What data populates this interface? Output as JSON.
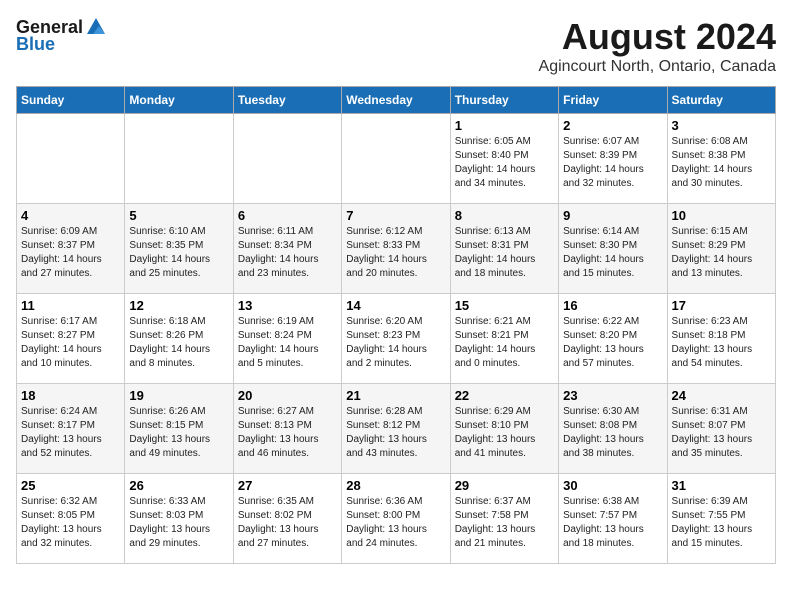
{
  "logo": {
    "general": "General",
    "blue": "Blue"
  },
  "title": {
    "month_year": "August 2024",
    "location": "Agincourt North, Ontario, Canada"
  },
  "days_of_week": [
    "Sunday",
    "Monday",
    "Tuesday",
    "Wednesday",
    "Thursday",
    "Friday",
    "Saturday"
  ],
  "weeks": [
    [
      {
        "day": "",
        "info": ""
      },
      {
        "day": "",
        "info": ""
      },
      {
        "day": "",
        "info": ""
      },
      {
        "day": "",
        "info": ""
      },
      {
        "day": "1",
        "info": "Sunrise: 6:05 AM\nSunset: 8:40 PM\nDaylight: 14 hours\nand 34 minutes."
      },
      {
        "day": "2",
        "info": "Sunrise: 6:07 AM\nSunset: 8:39 PM\nDaylight: 14 hours\nand 32 minutes."
      },
      {
        "day": "3",
        "info": "Sunrise: 6:08 AM\nSunset: 8:38 PM\nDaylight: 14 hours\nand 30 minutes."
      }
    ],
    [
      {
        "day": "4",
        "info": "Sunrise: 6:09 AM\nSunset: 8:37 PM\nDaylight: 14 hours\nand 27 minutes."
      },
      {
        "day": "5",
        "info": "Sunrise: 6:10 AM\nSunset: 8:35 PM\nDaylight: 14 hours\nand 25 minutes."
      },
      {
        "day": "6",
        "info": "Sunrise: 6:11 AM\nSunset: 8:34 PM\nDaylight: 14 hours\nand 23 minutes."
      },
      {
        "day": "7",
        "info": "Sunrise: 6:12 AM\nSunset: 8:33 PM\nDaylight: 14 hours\nand 20 minutes."
      },
      {
        "day": "8",
        "info": "Sunrise: 6:13 AM\nSunset: 8:31 PM\nDaylight: 14 hours\nand 18 minutes."
      },
      {
        "day": "9",
        "info": "Sunrise: 6:14 AM\nSunset: 8:30 PM\nDaylight: 14 hours\nand 15 minutes."
      },
      {
        "day": "10",
        "info": "Sunrise: 6:15 AM\nSunset: 8:29 PM\nDaylight: 14 hours\nand 13 minutes."
      }
    ],
    [
      {
        "day": "11",
        "info": "Sunrise: 6:17 AM\nSunset: 8:27 PM\nDaylight: 14 hours\nand 10 minutes."
      },
      {
        "day": "12",
        "info": "Sunrise: 6:18 AM\nSunset: 8:26 PM\nDaylight: 14 hours\nand 8 minutes."
      },
      {
        "day": "13",
        "info": "Sunrise: 6:19 AM\nSunset: 8:24 PM\nDaylight: 14 hours\nand 5 minutes."
      },
      {
        "day": "14",
        "info": "Sunrise: 6:20 AM\nSunset: 8:23 PM\nDaylight: 14 hours\nand 2 minutes."
      },
      {
        "day": "15",
        "info": "Sunrise: 6:21 AM\nSunset: 8:21 PM\nDaylight: 14 hours\nand 0 minutes."
      },
      {
        "day": "16",
        "info": "Sunrise: 6:22 AM\nSunset: 8:20 PM\nDaylight: 13 hours\nand 57 minutes."
      },
      {
        "day": "17",
        "info": "Sunrise: 6:23 AM\nSunset: 8:18 PM\nDaylight: 13 hours\nand 54 minutes."
      }
    ],
    [
      {
        "day": "18",
        "info": "Sunrise: 6:24 AM\nSunset: 8:17 PM\nDaylight: 13 hours\nand 52 minutes."
      },
      {
        "day": "19",
        "info": "Sunrise: 6:26 AM\nSunset: 8:15 PM\nDaylight: 13 hours\nand 49 minutes."
      },
      {
        "day": "20",
        "info": "Sunrise: 6:27 AM\nSunset: 8:13 PM\nDaylight: 13 hours\nand 46 minutes."
      },
      {
        "day": "21",
        "info": "Sunrise: 6:28 AM\nSunset: 8:12 PM\nDaylight: 13 hours\nand 43 minutes."
      },
      {
        "day": "22",
        "info": "Sunrise: 6:29 AM\nSunset: 8:10 PM\nDaylight: 13 hours\nand 41 minutes."
      },
      {
        "day": "23",
        "info": "Sunrise: 6:30 AM\nSunset: 8:08 PM\nDaylight: 13 hours\nand 38 minutes."
      },
      {
        "day": "24",
        "info": "Sunrise: 6:31 AM\nSunset: 8:07 PM\nDaylight: 13 hours\nand 35 minutes."
      }
    ],
    [
      {
        "day": "25",
        "info": "Sunrise: 6:32 AM\nSunset: 8:05 PM\nDaylight: 13 hours\nand 32 minutes."
      },
      {
        "day": "26",
        "info": "Sunrise: 6:33 AM\nSunset: 8:03 PM\nDaylight: 13 hours\nand 29 minutes."
      },
      {
        "day": "27",
        "info": "Sunrise: 6:35 AM\nSunset: 8:02 PM\nDaylight: 13 hours\nand 27 minutes."
      },
      {
        "day": "28",
        "info": "Sunrise: 6:36 AM\nSunset: 8:00 PM\nDaylight: 13 hours\nand 24 minutes."
      },
      {
        "day": "29",
        "info": "Sunrise: 6:37 AM\nSunset: 7:58 PM\nDaylight: 13 hours\nand 21 minutes."
      },
      {
        "day": "30",
        "info": "Sunrise: 6:38 AM\nSunset: 7:57 PM\nDaylight: 13 hours\nand 18 minutes."
      },
      {
        "day": "31",
        "info": "Sunrise: 6:39 AM\nSunset: 7:55 PM\nDaylight: 13 hours\nand 15 minutes."
      }
    ]
  ]
}
